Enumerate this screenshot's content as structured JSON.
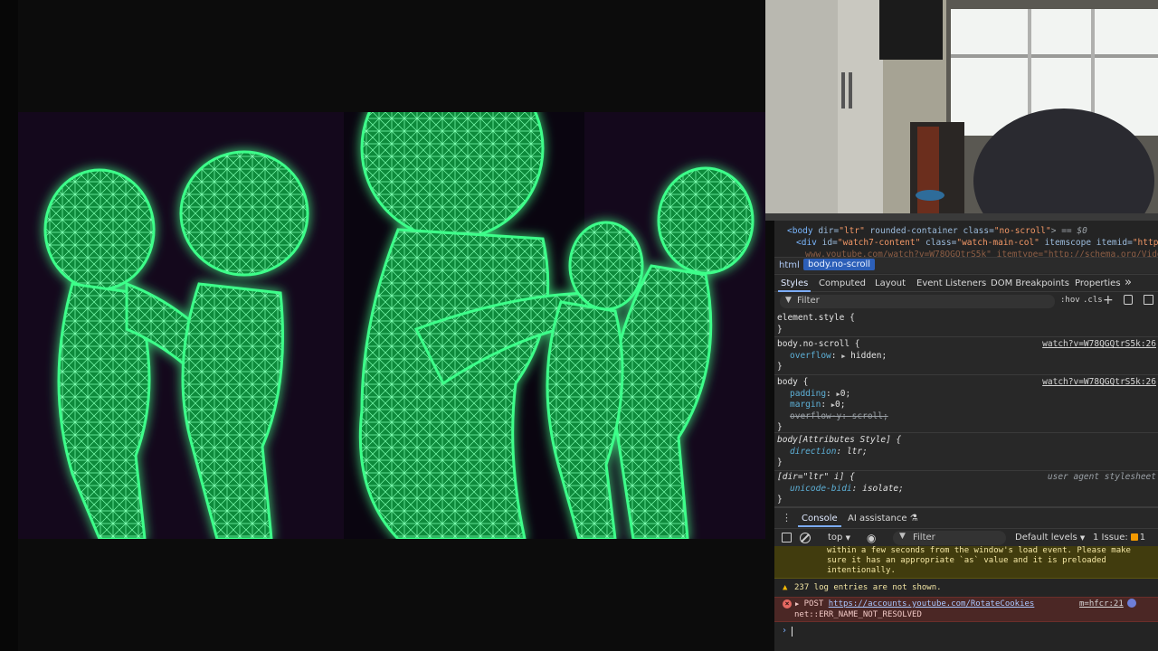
{
  "devtools": {
    "dom": {
      "line1": {
        "tag_open": "<body",
        "a1": " dir=",
        "v1": "\"ltr\"",
        "a2": " rounded-container class=",
        "v2": "\"no-scroll\"",
        "tail": "> == $0"
      },
      "line2": {
        "tag_open": "<div",
        "a1": " id=",
        "v1": "\"watch7-content\"",
        "a2": " class=",
        "v2": "\"watch-main-col\"",
        "a3": " itemscope itemid=",
        "v3": "\"https://w"
      },
      "line3": "www.youtube.com/watch?v=W78QGQtrS5k\" itemtype=\"http://schema.org/VideoObject"
    },
    "breadcrumb": {
      "html": "html",
      "body": "body.no-scroll"
    },
    "styles_tabs": [
      "Styles",
      "Computed",
      "Layout",
      "Event Listeners",
      "DOM Breakpoints",
      "Properties",
      "»"
    ],
    "filter": {
      "placeholder": "Filter",
      "hov": ":hov",
      "cls": ".cls",
      "plus": "+"
    },
    "rules": [
      {
        "selector": "element.style {",
        "close": "}"
      },
      {
        "selector": "body.no-scroll {",
        "source": "watch?v=W78QGQtrS5k:26",
        "prop": "overflow",
        "value": "hidden;",
        "close": "}"
      },
      {
        "selector": "body {",
        "source": "watch?v=W78QGQtrS5k:26",
        "props": [
          {
            "name": "padding",
            "value": "0;"
          },
          {
            "name": "margin",
            "value": "0;"
          },
          {
            "name": "overflow-y",
            "value": "scroll;"
          }
        ],
        "close": "}"
      },
      {
        "selector": "body[Attributes Style] {",
        "prop": "direction",
        "value": "ltr;",
        "close": "}"
      },
      {
        "selector": "[dir=\"ltr\" i] {",
        "source": "user agent stylesheet",
        "prop": "unicode-bidi",
        "value": "isolate;",
        "close": "}"
      }
    ],
    "console_tabs": {
      "console": "Console",
      "ai": "AI assistance"
    },
    "console_toolbar": {
      "context": "top",
      "filter": "Filter",
      "levels": "Default levels",
      "issues": "1 Issue:",
      "issue_count": "1"
    },
    "console": {
      "warning": "within a few seconds from the window's load event. Please make\nsure it has an appropriate `as` value and it is preloaded\nintentionally.",
      "hidden_note": "237 log entries are not shown.",
      "error_method": "POST",
      "error_url": "https://accounts.youtube.com/RotateCookies",
      "error_detail": "net::ERR_NAME_NOT_RESOLVED",
      "error_source": "m=hfcr:21",
      "prompt": "›"
    }
  },
  "colors": {
    "neon": "#2dff7a",
    "devtools_bg": "#282828",
    "warning_bg": "#413c0e",
    "error_bg": "#4b2725",
    "accent": "#7cacf8"
  },
  "icons": [
    "filter-icon",
    "plus-icon",
    "paint-icon",
    "sidebar-icon",
    "clear-icon",
    "eye-icon",
    "warning-icon",
    "error-icon"
  ]
}
